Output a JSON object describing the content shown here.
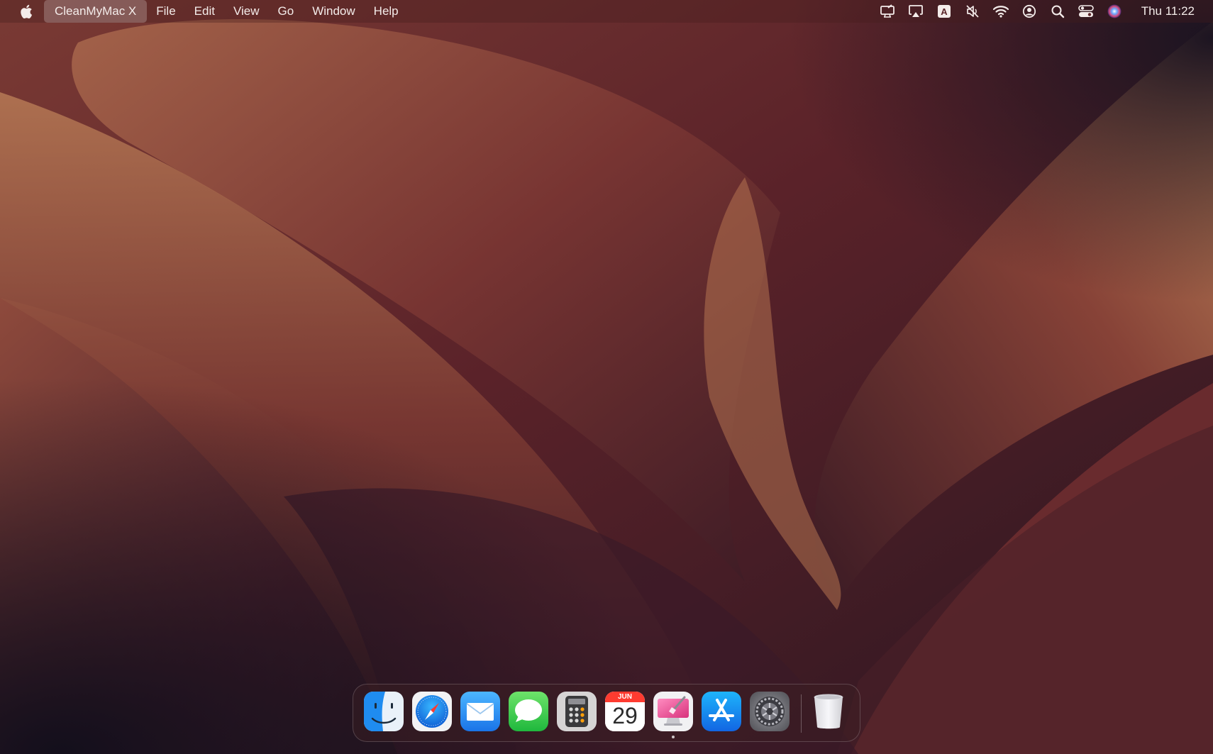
{
  "menubar": {
    "apple_icon": "apple-logo-icon",
    "app_name": "CleanMyMac X",
    "menus": [
      "File",
      "Edit",
      "View",
      "Go",
      "Window",
      "Help"
    ],
    "status_icons": [
      "cleanmymac-menu-icon",
      "airplay-icon",
      "input-source-icon",
      "speaker-muted-icon",
      "wifi-icon",
      "user-account-icon",
      "spotlight-search-icon",
      "control-center-icon",
      "siri-icon"
    ],
    "input_source_label": "A",
    "clock": "Thu 11:22"
  },
  "dock": {
    "apps": [
      {
        "name": "Finder",
        "icon": "finder-icon"
      },
      {
        "name": "Safari",
        "icon": "safari-icon"
      },
      {
        "name": "Mail",
        "icon": "mail-icon"
      },
      {
        "name": "Messages",
        "icon": "messages-icon"
      },
      {
        "name": "Calculator",
        "icon": "calculator-icon"
      },
      {
        "name": "Calendar",
        "icon": "calendar-icon",
        "month": "JUN",
        "day": "29"
      },
      {
        "name": "CleanMyMac X",
        "icon": "cleanmymac-icon",
        "running": true
      },
      {
        "name": "App Store",
        "icon": "app-store-icon"
      },
      {
        "name": "System Settings",
        "icon": "system-settings-icon"
      },
      {
        "name": "Trash",
        "icon": "trash-icon"
      }
    ]
  },
  "colors": {
    "wallpaper_dark": "#1a1220",
    "wallpaper_mid": "#5a2428",
    "wallpaper_light": "#b86e4e",
    "menubar_text": "#f4ecea"
  }
}
